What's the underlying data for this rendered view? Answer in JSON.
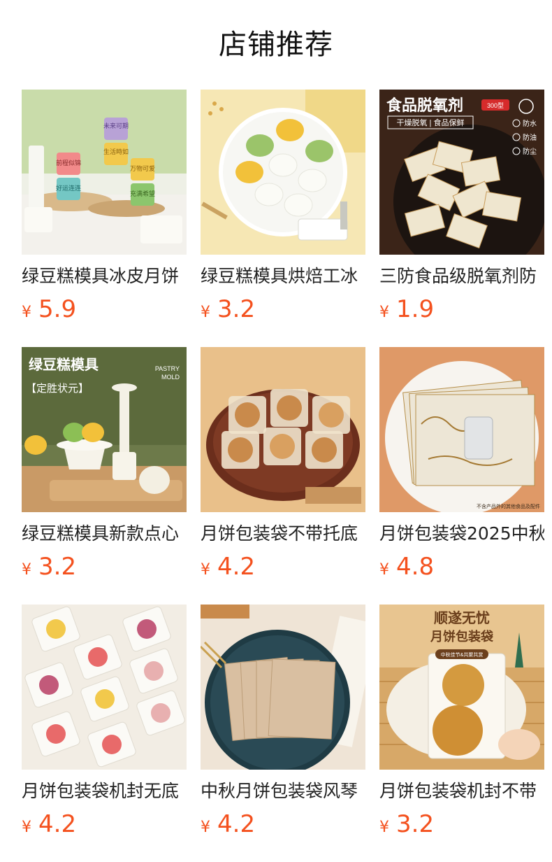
{
  "header": {
    "title": "店铺推荐"
  },
  "colors": {
    "price": "#f4511e",
    "text": "#222222",
    "background": "#ffffff"
  },
  "products": [
    {
      "name": "绿豆糕模具冰皮月饼",
      "currency": "¥",
      "price": "5.9",
      "image": {
        "subject": "mung-bean-cake-molds",
        "overlay_text": [
          "未来可期",
          "生活時如",
          "前程似锦",
          "万物可爱",
          "好运连连",
          "充满希望"
        ]
      }
    },
    {
      "name": "绿豆糕模具烘焙工冰",
      "currency": "¥",
      "price": "3.2",
      "image": {
        "subject": "colorful-cakes-on-plate",
        "overlay_text": []
      }
    },
    {
      "name": "三防食品级脱氧剂防",
      "currency": "¥",
      "price": "1.9",
      "image": {
        "subject": "oxygen-absorber-packets",
        "overlay_text": {
          "headline": "食品脱氧剂",
          "badge": "300型",
          "tagline": "干燥脱氧 | 食品保鲜",
          "features": [
            "防水",
            "防油",
            "防尘"
          ]
        }
      }
    },
    {
      "name": "绿豆糕模具新款点心",
      "currency": "¥",
      "price": "3.2",
      "image": {
        "subject": "pastry-mold-on-stand",
        "overlay_text": {
          "headline": "绿豆糕模具",
          "sub": "【定胜状元】",
          "corner": [
            "PASTRY",
            "MOLD"
          ]
        }
      }
    },
    {
      "name": "月饼包装袋不带托底",
      "currency": "¥",
      "price": "4.2",
      "image": {
        "subject": "mooncakes-in-bags-on-tray",
        "overlay_text": []
      }
    },
    {
      "name": "月饼包装袋2025中秋",
      "currency": "¥",
      "price": "4.8",
      "image": {
        "subject": "gold-pattern-bags",
        "overlay_text": [
          "不含产品外的其他食品及配件"
        ]
      }
    },
    {
      "name": "月饼包装袋机封无底",
      "currency": "¥",
      "price": "4.2",
      "image": {
        "subject": "colorful-pastries-in-bags",
        "overlay_text": []
      }
    },
    {
      "name": "中秋月饼包装袋风琴",
      "currency": "¥",
      "price": "4.2",
      "image": {
        "subject": "translucent-bags-on-plate",
        "overlay_text": []
      }
    },
    {
      "name": "月饼包装袋机封不带",
      "currency": "¥",
      "price": "3.2",
      "image": {
        "subject": "mooncakes-in-printed-bags",
        "overlay_text": {
          "headline": "顺遂无忧",
          "sub": "月饼包装袋",
          "label": "中秋佳节&共聚共赏"
        }
      }
    }
  ]
}
